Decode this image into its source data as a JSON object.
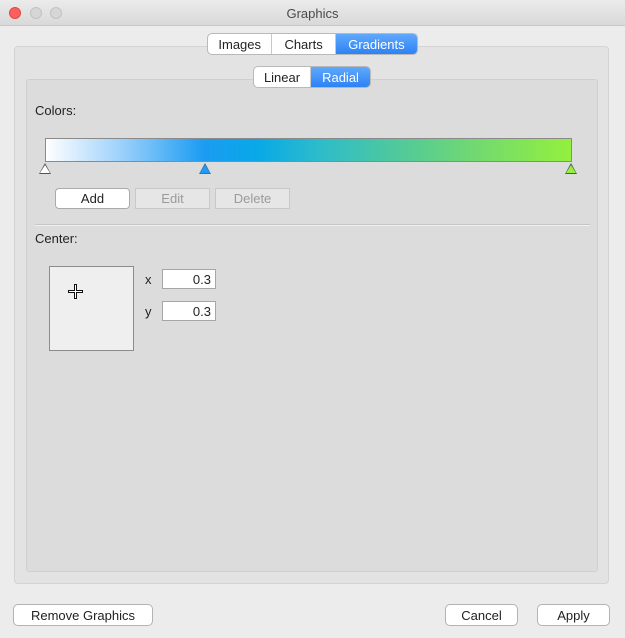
{
  "window": {
    "title": "Graphics"
  },
  "main_tabs": [
    {
      "label": "Images",
      "selected": false
    },
    {
      "label": "Charts",
      "selected": false
    },
    {
      "label": "Gradients",
      "selected": true
    }
  ],
  "sub_tabs": [
    {
      "label": "Linear",
      "selected": false
    },
    {
      "label": "Radial",
      "selected": true
    }
  ],
  "colors": {
    "label": "Colors:",
    "stops": [
      {
        "position": 0.0,
        "color": "#ffffff",
        "selected": false
      },
      {
        "position": 0.305,
        "color": "#1c9cf2",
        "selected": true
      },
      {
        "position": 1.0,
        "color": "#93f03d",
        "selected": false
      }
    ],
    "add_label": "Add",
    "edit_label": "Edit",
    "delete_label": "Delete"
  },
  "center": {
    "label": "Center:",
    "x_label": "x",
    "y_label": "y",
    "x_value": "0.3",
    "y_value": "0.3"
  },
  "footer": {
    "remove_label": "Remove Graphics",
    "cancel_label": "Cancel",
    "apply_label": "Apply"
  },
  "accent_color": "#2d82f5"
}
